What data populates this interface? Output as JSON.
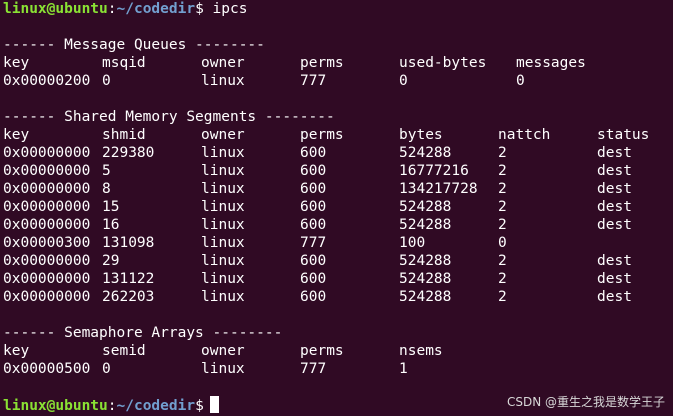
{
  "prompt": {
    "user_host": "linux@ubuntu",
    "colon": ":",
    "path": "~/codedir",
    "dollar": "$ ",
    "command": "ipcs"
  },
  "message_queues": {
    "heading": "------ Message Queues --------",
    "headers": [
      "key",
      "msqid",
      "owner",
      "perms",
      "used-bytes",
      "messages"
    ],
    "rows": [
      [
        "0x00000200",
        "0",
        "linux",
        "777",
        "0",
        "0"
      ]
    ]
  },
  "shared_memory": {
    "heading": "------ Shared Memory Segments --------",
    "headers": [
      "key",
      "shmid",
      "owner",
      "perms",
      "bytes",
      "nattch",
      "status"
    ],
    "rows": [
      [
        "0x00000000",
        "229380",
        "linux",
        "600",
        "524288",
        "2",
        "dest"
      ],
      [
        "0x00000000",
        "5",
        "linux",
        "600",
        "16777216",
        "2",
        "dest"
      ],
      [
        "0x00000000",
        "8",
        "linux",
        "600",
        "134217728",
        "2",
        "dest"
      ],
      [
        "0x00000000",
        "15",
        "linux",
        "600",
        "524288",
        "2",
        "dest"
      ],
      [
        "0x00000000",
        "16",
        "linux",
        "600",
        "524288",
        "2",
        "dest"
      ],
      [
        "0x00000300",
        "131098",
        "linux",
        "777",
        "100",
        "0",
        ""
      ],
      [
        "0x00000000",
        "29",
        "linux",
        "600",
        "524288",
        "2",
        "dest"
      ],
      [
        "0x00000000",
        "131122",
        "linux",
        "600",
        "524288",
        "2",
        "dest"
      ],
      [
        "0x00000000",
        "262203",
        "linux",
        "600",
        "524288",
        "2",
        "dest"
      ]
    ]
  },
  "semaphore_arrays": {
    "heading": "------ Semaphore Arrays --------",
    "headers": [
      "key",
      "semid",
      "owner",
      "perms",
      "nsems"
    ],
    "rows": [
      [
        "0x00000500",
        "0",
        "linux",
        "777",
        "1"
      ]
    ]
  },
  "final_prompt": {
    "user_host": "linux@ubuntu",
    "colon": ":",
    "path": "~/codedir",
    "dollar": "$"
  },
  "watermark": "CSDN @重生之我是数学王子",
  "colors": {
    "background": "#300a24",
    "prompt_user": "#8ae234",
    "prompt_path": "#729fcf",
    "text": "#ffffff"
  }
}
